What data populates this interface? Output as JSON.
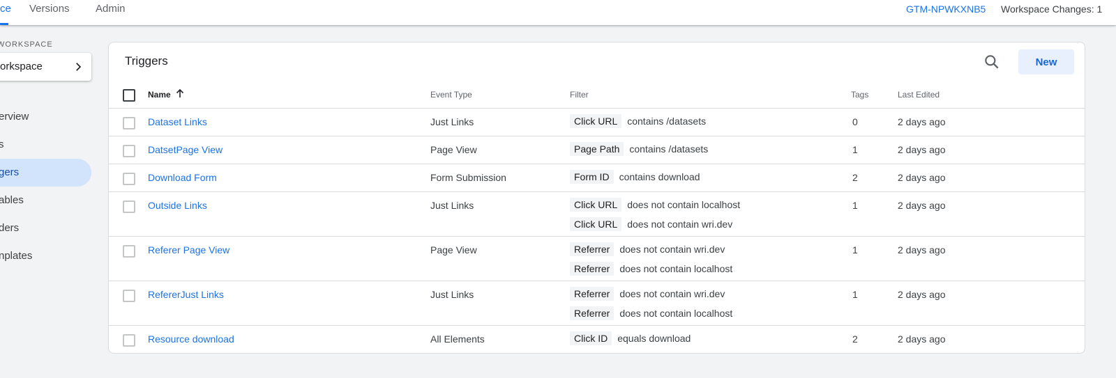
{
  "topbar": {
    "tabs": [
      {
        "label": "ce",
        "active": true
      },
      {
        "label": "Versions",
        "active": false
      },
      {
        "label": "Admin",
        "active": false
      }
    ],
    "container_id": "GTM-NPWKXNB5",
    "workspace_changes": "Workspace Changes: 1"
  },
  "sidebar": {
    "section_label": "WORKSPACE",
    "workspace_picker": "orkspace",
    "items": [
      {
        "label": "erview",
        "active": false
      },
      {
        "label": "s",
        "active": false
      },
      {
        "label": "gers",
        "active": true
      },
      {
        "label": "ables",
        "active": false
      },
      {
        "label": "ders",
        "active": false
      },
      {
        "label": "nplates",
        "active": false
      }
    ]
  },
  "card": {
    "title": "Triggers",
    "new_button": "New",
    "columns": {
      "name": "Name",
      "event_type": "Event Type",
      "filter": "Filter",
      "tags": "Tags",
      "last_edited": "Last Edited"
    },
    "rows": [
      {
        "name": "Dataset Links",
        "event_type": "Just Links",
        "filters": [
          {
            "chip": "Click URL",
            "text": "contains /datasets"
          }
        ],
        "tags": "0",
        "last_edited": "2 days ago"
      },
      {
        "name": "DatsetPage View",
        "event_type": "Page View",
        "filters": [
          {
            "chip": "Page Path",
            "text": "contains /datasets"
          }
        ],
        "tags": "1",
        "last_edited": "2 days ago"
      },
      {
        "name": "Download Form",
        "event_type": "Form Submission",
        "filters": [
          {
            "chip": "Form ID",
            "text": "contains download"
          }
        ],
        "tags": "2",
        "last_edited": "2 days ago"
      },
      {
        "name": "Outside Links",
        "event_type": "Just Links",
        "filters": [
          {
            "chip": "Click URL",
            "text": "does not contain localhost"
          },
          {
            "chip": "Click URL",
            "text": "does not contain wri.dev"
          }
        ],
        "tags": "1",
        "last_edited": "2 days ago"
      },
      {
        "name": "Referer Page View",
        "event_type": "Page View",
        "filters": [
          {
            "chip": "Referrer",
            "text": "does not contain wri.dev"
          },
          {
            "chip": "Referrer",
            "text": "does not contain localhost"
          }
        ],
        "tags": "1",
        "last_edited": "2 days ago"
      },
      {
        "name": "RefererJust Links",
        "event_type": "Just Links",
        "filters": [
          {
            "chip": "Referrer",
            "text": "does not contain wri.dev"
          },
          {
            "chip": "Referrer",
            "text": "does not contain localhost"
          }
        ],
        "tags": "1",
        "last_edited": "2 days ago"
      },
      {
        "name": "Resource download",
        "event_type": "All Elements",
        "filters": [
          {
            "chip": "Click ID",
            "text": "equals download"
          }
        ],
        "tags": "2",
        "last_edited": "2 days ago"
      }
    ]
  }
}
